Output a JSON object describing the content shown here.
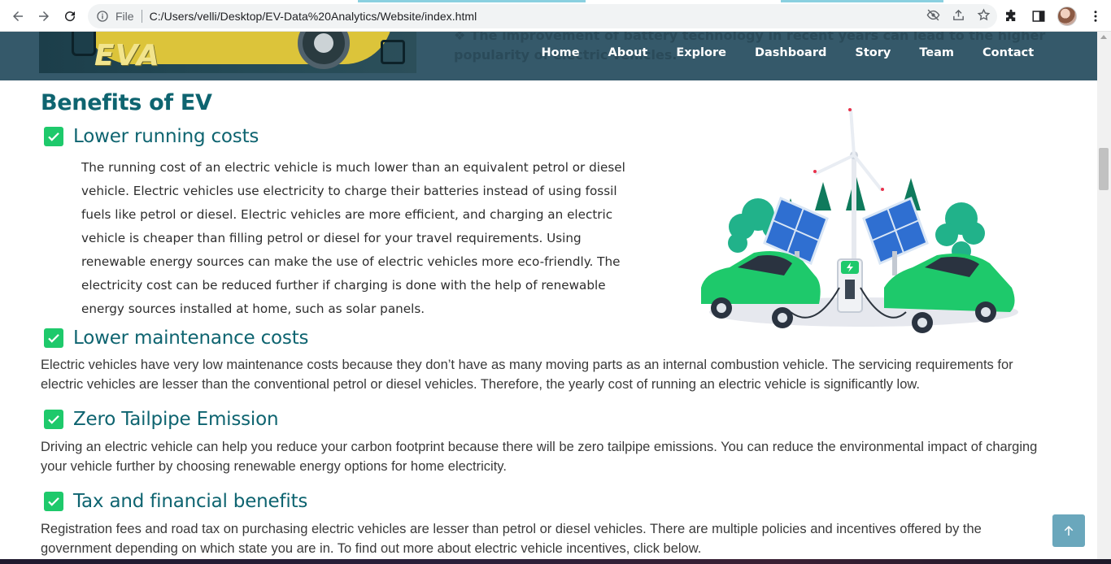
{
  "browser": {
    "file_label": "File",
    "url": "C:/Users/velli/Desktop/EV-Data%20Analytics/Website/index.html"
  },
  "site": {
    "logo": "EVA",
    "background_text": "The improvement of battery technology in recent years can lead to the higher popularity of electric vehicles.",
    "nav": {
      "home": "Home",
      "about": "About",
      "explore": "Explore",
      "dashboard": "Dashboard",
      "story": "Story",
      "team": "Team",
      "contact": "Contact"
    }
  },
  "benefits": {
    "title": "Benefits of EV",
    "items": [
      {
        "title": "Lower running costs",
        "text": "The running cost of an electric vehicle is much lower than an equivalent petrol or diesel vehicle. Electric vehicles use electricity to charge their batteries instead of using fossil fuels like petrol or diesel. Electric vehicles are more efficient, and charging an electric vehicle is cheaper than filling petrol or diesel for your travel requirements. Using renewable energy sources can make the use of electric vehicles more eco-friendly. The electricity cost can be reduced further if charging is done with the help of renewable energy sources installed at home, such as solar panels."
      },
      {
        "title": "Lower maintenance costs",
        "text": "Electric vehicles have very low maintenance costs because they don’t have as many moving parts as an internal combustion vehicle. The servicing requirements for electric vehicles are lesser than the conventional petrol or diesel vehicles. Therefore, the yearly cost of running an electric vehicle is significantly low."
      },
      {
        "title": "Zero Tailpipe Emission",
        "text": "Driving an electric vehicle can help you reduce your carbon footprint because there will be zero tailpipe emissions. You can reduce the environmental impact of charging your vehicle further by choosing renewable energy options for home electricity."
      },
      {
        "title": "Tax and financial benefits",
        "text": "Registration fees and road tax on purchasing electric vehicles are lesser than petrol or diesel vehicles. There are multiple policies and incentives offered by the government depending on which state you are in. To find out more about electric vehicle incentives, click below."
      }
    ]
  },
  "colors": {
    "header_bg": "#35596a",
    "heading": "#0e6470",
    "check": "#1ec96b",
    "to_top": "#6aa7bc"
  },
  "icons": [
    "back-arrow-icon",
    "forward-arrow-icon",
    "reload-icon",
    "info-icon",
    "eye-off-icon",
    "share-icon",
    "star-icon",
    "puzzle-icon",
    "sidebar-icon",
    "menu-dots-icon",
    "check-icon",
    "arrow-up-icon"
  ]
}
